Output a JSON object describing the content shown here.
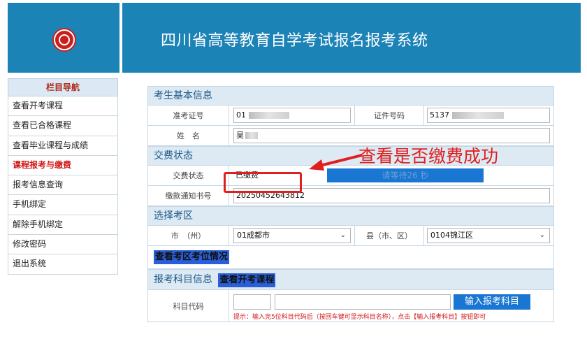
{
  "header": {
    "title": "四川省高等教育自学考试报名报考系统",
    "brand_color": "#1c83b7",
    "logo_icon": "seal-logo-icon"
  },
  "sidebar": {
    "title": "栏目导航",
    "items": [
      {
        "label": "查看开考课程",
        "active": false
      },
      {
        "label": "查看已合格课程",
        "active": false
      },
      {
        "label": "查看毕业课程与成绩",
        "active": false
      },
      {
        "label": "课程报考与缴费",
        "active": true
      },
      {
        "label": "报考信息查询",
        "active": false
      },
      {
        "label": "手机绑定",
        "active": false
      },
      {
        "label": "解除手机绑定",
        "active": false
      },
      {
        "label": "修改密码",
        "active": false
      },
      {
        "label": "退出系统",
        "active": false
      }
    ]
  },
  "basic_info": {
    "section_title": "考生基本信息",
    "exam_no_label": "准考证号",
    "exam_no_value": "01",
    "id_label": "证件号码",
    "id_value": "5137",
    "name_label": "姓　名",
    "name_value": "吴"
  },
  "payment": {
    "section_title": "交费状态",
    "status_label": "交费状态",
    "status_value": "已缴费",
    "countdown_text": "请等待26 秒",
    "notice_label": "缴款通知书号",
    "notice_value": "20250452643812"
  },
  "exam_area": {
    "section_title": "选择考区",
    "city_label": "市　（州）",
    "city_value": "01成都市",
    "county_label": "县（市、区）",
    "county_value": "0104锦江区",
    "view_seats_label": "查看考区考位情况"
  },
  "subjects": {
    "section_title": "报考科目信息",
    "view_courses_label": "查看开考课程",
    "code_label": "科目代码",
    "enter_button": "输入报考科目",
    "hint": "提示：输入完5位科目代码后（按回车键可显示科目名称），点击【输入报考科目】按钮即可"
  },
  "annotation": {
    "text": "查看是否缴费成功",
    "color": "#e02020"
  }
}
